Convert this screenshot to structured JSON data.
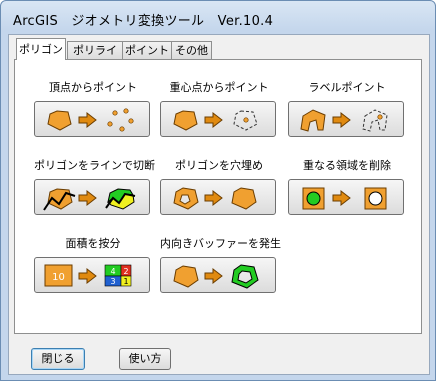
{
  "window": {
    "title": "ArcGIS　ジオメトリ変換ツール　Ver.10.4"
  },
  "tabs": [
    {
      "label": "ポリゴン",
      "active": true
    },
    {
      "label": "ポリライン",
      "active": false
    },
    {
      "label": "ポイント",
      "active": false
    },
    {
      "label": "その他",
      "active": false
    }
  ],
  "tools": [
    {
      "label": "頂点からポイント",
      "icon": "polygon-to-vertex-points-icon"
    },
    {
      "label": "重心点からポイント",
      "icon": "polygon-to-centroid-point-icon"
    },
    {
      "label": "ラベルポイント",
      "icon": "polygon-to-label-point-icon"
    },
    {
      "label": "ポリゴンをラインで切断",
      "icon": "split-polygon-by-line-icon"
    },
    {
      "label": "ポリゴンを穴埋め",
      "icon": "fill-polygon-hole-icon"
    },
    {
      "label": "重なる領域を削除",
      "icon": "erase-overlap-icon"
    },
    {
      "label": "面積を按分",
      "icon": "apportion-area-icon",
      "icon_text": [
        "10",
        "4",
        "2",
        "3",
        "1"
      ]
    },
    {
      "label": "内向きバッファーを発生",
      "icon": "inner-buffer-icon"
    }
  ],
  "footer": {
    "close_label": "閉じる",
    "help_label": "使い方"
  },
  "colors": {
    "orange": "#f0a030",
    "arrow": "#e08a10",
    "green": "#22cc22",
    "yellow": "#f0f020",
    "blue": "#2060d0",
    "red": "#e03020"
  }
}
